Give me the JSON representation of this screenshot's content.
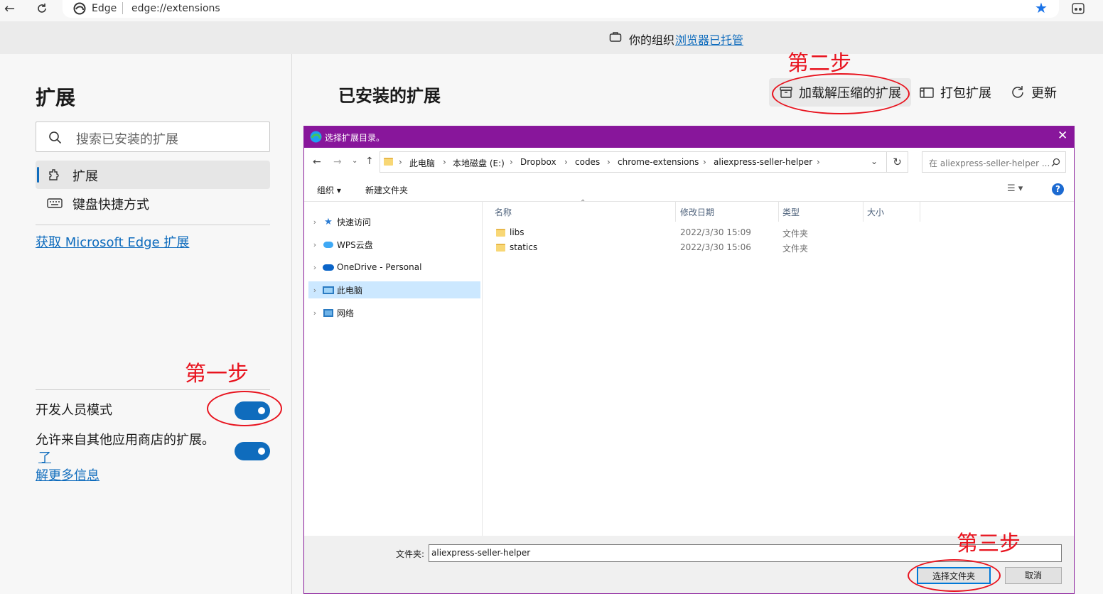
{
  "browser": {
    "tab_label": "Edge",
    "url": "edge://extensions"
  },
  "managed_bar": {
    "prefix": "你的组织",
    "link": "浏览器已托管"
  },
  "sidebar": {
    "title": "扩展",
    "search_placeholder": "搜索已安装的扩展",
    "items": [
      {
        "label": "扩展",
        "selected": true
      },
      {
        "label": "键盘快捷方式",
        "selected": false
      }
    ],
    "store_link": "获取 Microsoft Edge 扩展",
    "dev_mode_label": "开发人员模式",
    "other_stores_text": "允许来自其他应用商店的扩展。",
    "other_stores_link_part1": "了",
    "other_stores_link_part2": "解更多信息"
  },
  "main": {
    "title": "已安装的扩展",
    "actions": {
      "load_unpacked": "加载解压缩的扩展",
      "pack": "打包扩展",
      "update": "更新"
    }
  },
  "dialog": {
    "title": "选择扩展目录。",
    "breadcrumbs": [
      "此电脑",
      "本地磁盘 (E:)",
      "Dropbox",
      "codes",
      "chrome-extensions",
      "aliexpress-seller-helper"
    ],
    "search_placeholder": "在 aliexpress-seller-helper ...",
    "toolbar": {
      "organize": "组织",
      "new_folder": "新建文件夹"
    },
    "tree": [
      {
        "label": "快速访问",
        "selected": false
      },
      {
        "label": "WPS云盘",
        "selected": false
      },
      {
        "label": "OneDrive - Personal",
        "selected": false
      },
      {
        "label": "此电脑",
        "selected": true
      },
      {
        "label": "网络",
        "selected": false
      }
    ],
    "columns": [
      "名称",
      "修改日期",
      "类型",
      "大小"
    ],
    "files": [
      {
        "name": "libs",
        "date": "2022/3/30 15:09",
        "type": "文件夹",
        "size": ""
      },
      {
        "name": "statics",
        "date": "2022/3/30 15:06",
        "type": "文件夹",
        "size": ""
      }
    ],
    "folder_label": "文件夹:",
    "folder_value": "aliexpress-seller-helper",
    "select_button": "选择文件夹",
    "cancel_button": "取消"
  },
  "annotations": {
    "step1": "第一步",
    "step2": "第二步",
    "step3": "第三步"
  },
  "colors": {
    "accent": "#0f6cbd",
    "dialog_title": "#88169b",
    "annotation": "#e8141f"
  }
}
